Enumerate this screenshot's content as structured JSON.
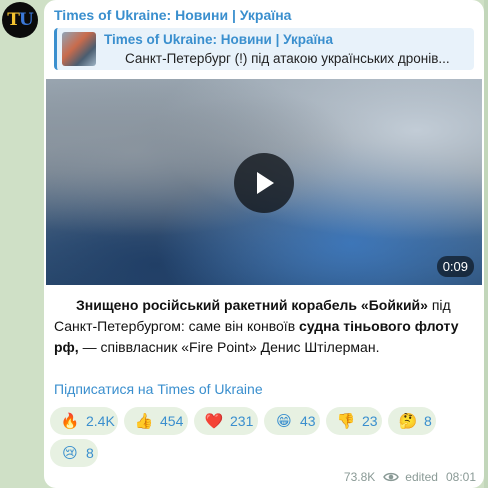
{
  "avatar": {
    "letter1": "T",
    "letter2": "U"
  },
  "channel": {
    "name": "Times of Ukraine: Новини | Україна"
  },
  "reply": {
    "title": "Times of Ukraine: Новини | Україна",
    "text": "Санкт-Петербург (!) під атакою українських дронів..."
  },
  "video": {
    "duration": "0:09",
    "play_icon": "play-icon"
  },
  "message": {
    "part1": "Знищено російський ракетний корабель «Бойкий»",
    "part2": " під Санкт-Петербургом: саме він конвоїв ",
    "part3": "судна тіньового флоту рф,",
    "part4": " — співвласник «Fire Point» Денис Штілерман."
  },
  "subscribe_link": "Підписатися на Times of Ukraine",
  "reactions": [
    {
      "emoji": "🔥",
      "count": "2.4K"
    },
    {
      "emoji": "👍",
      "count": "454"
    },
    {
      "emoji": "❤️",
      "count": "231"
    },
    {
      "emoji": "😁",
      "count": "43"
    },
    {
      "emoji": "👎",
      "count": "23"
    },
    {
      "emoji": "🤔",
      "count": "8"
    },
    {
      "emoji": "😢",
      "count": "8"
    }
  ],
  "footer": {
    "views": "73.8K",
    "edited": "edited",
    "time": "08:01"
  },
  "colors": {
    "accent": "#3a8fce",
    "background": "#cfe0c6",
    "reaction_bg": "#e7f1e2"
  }
}
